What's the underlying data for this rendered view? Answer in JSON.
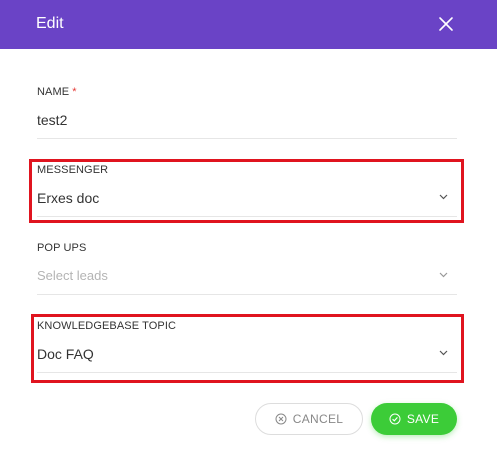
{
  "modal": {
    "title": "Edit",
    "close_icon": "close-icon"
  },
  "fields": {
    "name": {
      "label": "NAME",
      "required_mark": "*",
      "value": "test2"
    },
    "messenger": {
      "label": "MESSENGER",
      "value": "Erxes doc"
    },
    "popups": {
      "label": "POP UPS",
      "placeholder": "Select leads"
    },
    "knowledgebase": {
      "label": "KNOWLEDGEBASE TOPIC",
      "value": "Doc FAQ"
    }
  },
  "actions": {
    "cancel_label": "CANCEL",
    "cancel_icon": "cancel-circle-icon",
    "save_label": "SAVE",
    "save_icon": "check-circle-icon"
  },
  "colors": {
    "header": "#6a43c6",
    "highlight": "#e0141f",
    "save": "#3ccc38"
  }
}
